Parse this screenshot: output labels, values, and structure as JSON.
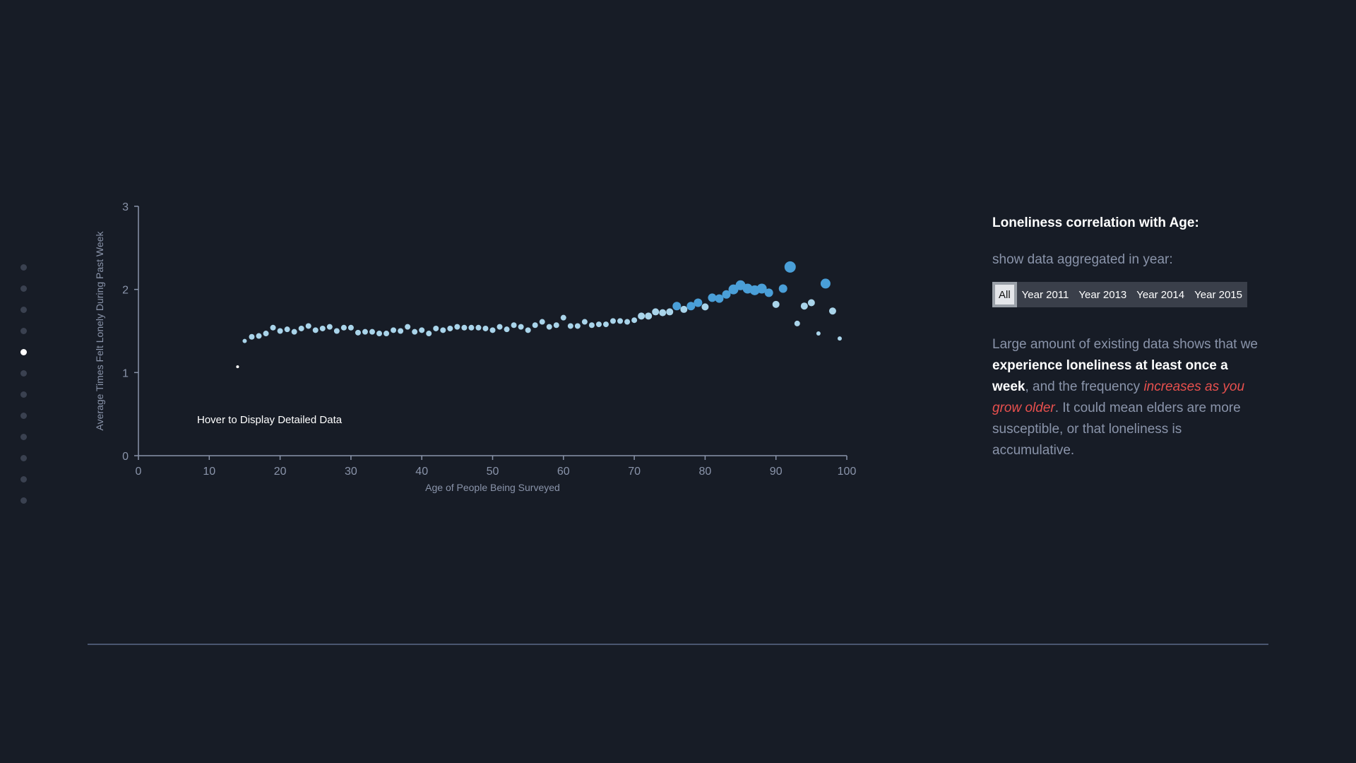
{
  "nav": {
    "count": 12,
    "active_index": 4
  },
  "chart_data": {
    "type": "scatter",
    "xlabel": "Age of People Being Surveyed",
    "ylabel": "Average Times Felt Lonely During Past Week",
    "xlim": [
      0,
      100
    ],
    "ylim": [
      0,
      3
    ],
    "x_ticks": [
      "0",
      "10",
      "20",
      "30",
      "40",
      "50",
      "60",
      "70",
      "80",
      "90",
      "100"
    ],
    "y_ticks": [
      "0",
      "1",
      "2",
      "3"
    ],
    "grid": false,
    "hint": "Hover to Display Detailed Data",
    "points": [
      {
        "x": 14,
        "y": 1.07,
        "n": 1
      },
      {
        "x": 15,
        "y": 1.38,
        "n": 2
      },
      {
        "x": 16,
        "y": 1.43,
        "n": 3
      },
      {
        "x": 17,
        "y": 1.44,
        "n": 3
      },
      {
        "x": 18,
        "y": 1.47,
        "n": 3
      },
      {
        "x": 19,
        "y": 1.54,
        "n": 3
      },
      {
        "x": 20,
        "y": 1.5,
        "n": 3
      },
      {
        "x": 21,
        "y": 1.52,
        "n": 3
      },
      {
        "x": 22,
        "y": 1.49,
        "n": 3
      },
      {
        "x": 23,
        "y": 1.53,
        "n": 3
      },
      {
        "x": 24,
        "y": 1.56,
        "n": 3
      },
      {
        "x": 25,
        "y": 1.51,
        "n": 3
      },
      {
        "x": 26,
        "y": 1.53,
        "n": 3
      },
      {
        "x": 27,
        "y": 1.55,
        "n": 3
      },
      {
        "x": 28,
        "y": 1.5,
        "n": 3
      },
      {
        "x": 29,
        "y": 1.54,
        "n": 3
      },
      {
        "x": 30,
        "y": 1.54,
        "n": 3
      },
      {
        "x": 31,
        "y": 1.48,
        "n": 3
      },
      {
        "x": 32,
        "y": 1.49,
        "n": 3
      },
      {
        "x": 33,
        "y": 1.49,
        "n": 3
      },
      {
        "x": 34,
        "y": 1.47,
        "n": 3
      },
      {
        "x": 35,
        "y": 1.47,
        "n": 3
      },
      {
        "x": 36,
        "y": 1.51,
        "n": 3
      },
      {
        "x": 37,
        "y": 1.5,
        "n": 3
      },
      {
        "x": 38,
        "y": 1.55,
        "n": 3
      },
      {
        "x": 39,
        "y": 1.49,
        "n": 3
      },
      {
        "x": 40,
        "y": 1.51,
        "n": 3
      },
      {
        "x": 41,
        "y": 1.47,
        "n": 3
      },
      {
        "x": 42,
        "y": 1.53,
        "n": 3
      },
      {
        "x": 43,
        "y": 1.51,
        "n": 3
      },
      {
        "x": 44,
        "y": 1.53,
        "n": 3
      },
      {
        "x": 45,
        "y": 1.55,
        "n": 3
      },
      {
        "x": 46,
        "y": 1.54,
        "n": 3
      },
      {
        "x": 47,
        "y": 1.54,
        "n": 3
      },
      {
        "x": 48,
        "y": 1.54,
        "n": 3
      },
      {
        "x": 49,
        "y": 1.53,
        "n": 3
      },
      {
        "x": 50,
        "y": 1.51,
        "n": 3
      },
      {
        "x": 51,
        "y": 1.55,
        "n": 3
      },
      {
        "x": 52,
        "y": 1.52,
        "n": 3
      },
      {
        "x": 53,
        "y": 1.57,
        "n": 3
      },
      {
        "x": 54,
        "y": 1.55,
        "n": 3
      },
      {
        "x": 55,
        "y": 1.51,
        "n": 3
      },
      {
        "x": 56,
        "y": 1.57,
        "n": 3
      },
      {
        "x": 57,
        "y": 1.61,
        "n": 3
      },
      {
        "x": 58,
        "y": 1.55,
        "n": 3
      },
      {
        "x": 59,
        "y": 1.57,
        "n": 3
      },
      {
        "x": 60,
        "y": 1.66,
        "n": 3
      },
      {
        "x": 61,
        "y": 1.56,
        "n": 3
      },
      {
        "x": 62,
        "y": 1.56,
        "n": 3
      },
      {
        "x": 63,
        "y": 1.61,
        "n": 3
      },
      {
        "x": 64,
        "y": 1.57,
        "n": 3
      },
      {
        "x": 65,
        "y": 1.58,
        "n": 3
      },
      {
        "x": 66,
        "y": 1.58,
        "n": 3
      },
      {
        "x": 67,
        "y": 1.62,
        "n": 3
      },
      {
        "x": 68,
        "y": 1.62,
        "n": 3
      },
      {
        "x": 69,
        "y": 1.61,
        "n": 3
      },
      {
        "x": 70,
        "y": 1.63,
        "n": 3
      },
      {
        "x": 71,
        "y": 1.68,
        "n": 4
      },
      {
        "x": 72,
        "y": 1.68,
        "n": 4
      },
      {
        "x": 73,
        "y": 1.73,
        "n": 4
      },
      {
        "x": 74,
        "y": 1.72,
        "n": 4
      },
      {
        "x": 75,
        "y": 1.73,
        "n": 4
      },
      {
        "x": 76,
        "y": 1.8,
        "n": 5
      },
      {
        "x": 77,
        "y": 1.76,
        "n": 4
      },
      {
        "x": 78,
        "y": 1.8,
        "n": 5
      },
      {
        "x": 79,
        "y": 1.84,
        "n": 5
      },
      {
        "x": 80,
        "y": 1.79,
        "n": 4
      },
      {
        "x": 81,
        "y": 1.9,
        "n": 5
      },
      {
        "x": 82,
        "y": 1.89,
        "n": 5
      },
      {
        "x": 83,
        "y": 1.94,
        "n": 5
      },
      {
        "x": 84,
        "y": 2.0,
        "n": 6
      },
      {
        "x": 85,
        "y": 2.05,
        "n": 6
      },
      {
        "x": 86,
        "y": 2.01,
        "n": 6
      },
      {
        "x": 87,
        "y": 1.99,
        "n": 6
      },
      {
        "x": 88,
        "y": 2.01,
        "n": 6
      },
      {
        "x": 89,
        "y": 1.96,
        "n": 5
      },
      {
        "x": 90,
        "y": 1.82,
        "n": 4
      },
      {
        "x": 91,
        "y": 2.01,
        "n": 5
      },
      {
        "x": 92,
        "y": 2.27,
        "n": 7
      },
      {
        "x": 93,
        "y": 1.59,
        "n": 3
      },
      {
        "x": 94,
        "y": 1.8,
        "n": 4
      },
      {
        "x": 95,
        "y": 1.84,
        "n": 4
      },
      {
        "x": 96,
        "y": 1.47,
        "n": 2
      },
      {
        "x": 97,
        "y": 2.07,
        "n": 6
      },
      {
        "x": 98,
        "y": 1.74,
        "n": 4
      },
      {
        "x": 99,
        "y": 1.41,
        "n": 2
      }
    ],
    "colors": {
      "point": "#a9d4ea",
      "point_large": "#4a9fd8",
      "axis": "#8a94aa"
    }
  },
  "panel": {
    "title": "Loneliness correlation with Age:",
    "subtitle": "show data aggregated in year:",
    "year_options": [
      "All",
      "Year 2011",
      "Year 2013",
      "Year 2014",
      "Year 2015"
    ],
    "selected_year": "All",
    "body": {
      "p1": "Large amount of existing data shows that we ",
      "p2": "experience loneliness at least once a week",
      "p3": ", and the frequency ",
      "p4": "increases as you grow older",
      "p5": ". It could mean elders are more susceptible, or that loneliness is accumulative."
    }
  }
}
